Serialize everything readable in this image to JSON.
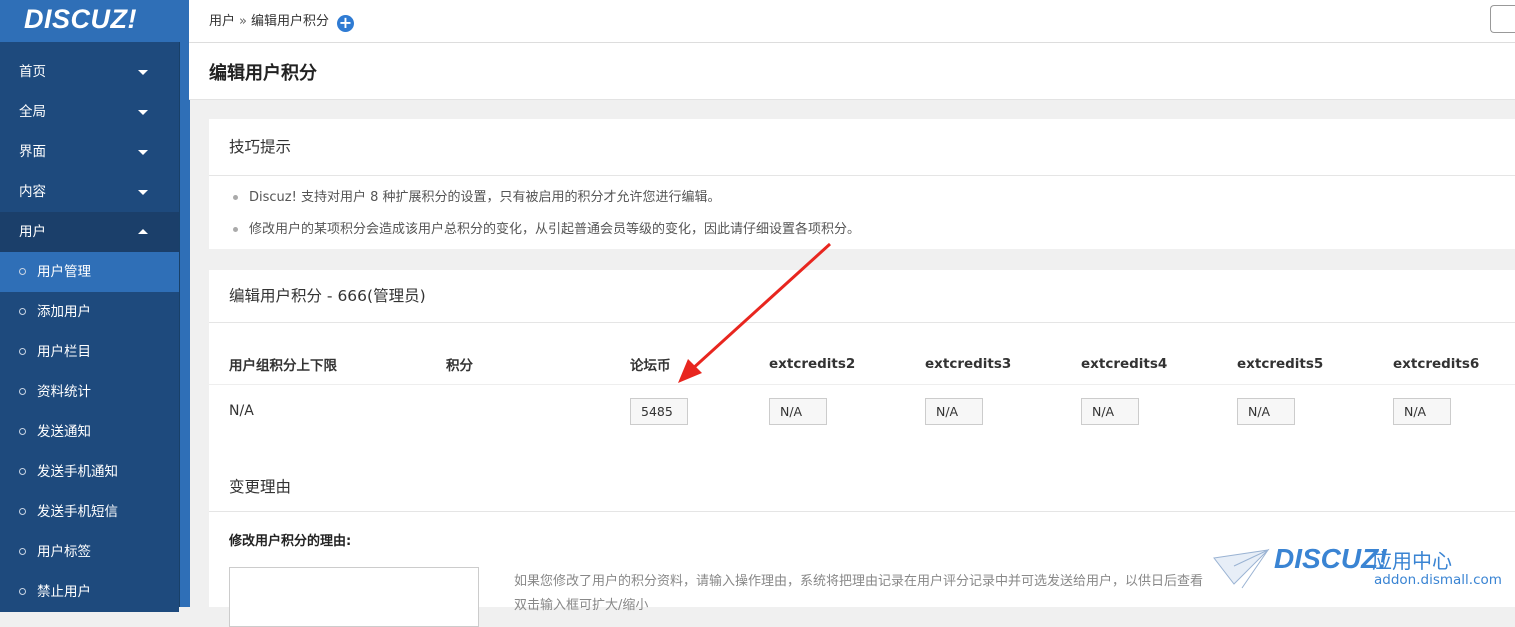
{
  "logo": "DISCUZ!",
  "nav": [
    {
      "label": "首页"
    },
    {
      "label": "全局"
    },
    {
      "label": "界面"
    },
    {
      "label": "内容"
    },
    {
      "label": "用户"
    }
  ],
  "subnav": [
    {
      "label": "用户管理"
    },
    {
      "label": "添加用户"
    },
    {
      "label": "用户栏目"
    },
    {
      "label": "资料统计"
    },
    {
      "label": "发送通知"
    },
    {
      "label": "发送手机通知"
    },
    {
      "label": "发送手机短信"
    },
    {
      "label": "用户标签"
    },
    {
      "label": "禁止用户"
    }
  ],
  "breadcrumb": {
    "part1": "用户",
    "sep": "»",
    "part2": "编辑用户积分",
    "add_icon": "+"
  },
  "page_title": "编辑用户积分",
  "tips": {
    "title": "技巧提示",
    "items": [
      "Discuz! 支持对用户 8 种扩展积分的设置，只有被启用的积分才允许您进行编辑。",
      "修改用户的某项积分会造成该用户总积分的变化，从引起普通会员等级的变化，因此请仔细设置各项积分。"
    ]
  },
  "edit": {
    "title": "编辑用户积分 - 666(管理员)",
    "headers": [
      "用户组积分上下限",
      "积分",
      "论坛币",
      "extcredits2",
      "extcredits3",
      "extcredits4",
      "extcredits5",
      "extcredits6"
    ],
    "limit_value": "N/A",
    "points_value": "",
    "values": [
      "5485",
      "N/A",
      "N/A",
      "N/A",
      "N/A",
      "N/A"
    ]
  },
  "reason": {
    "title": "变更理由",
    "label": "修改用户积分的理由:",
    "help": "如果您修改了用户的积分资料，请输入操作理由，系统将把理由记录在用户评分记录中并可选发送给用户，以供日后查看",
    "help2": "双击输入框可扩大/缩小"
  },
  "watermark": {
    "brand": "DISCUZ!",
    "sub": "应用中心",
    "url": "addon.dismall.com"
  },
  "colors": {
    "sidebar": "#1e4a7d",
    "accent": "#2f6fb7",
    "arrow": "#e8261f"
  }
}
